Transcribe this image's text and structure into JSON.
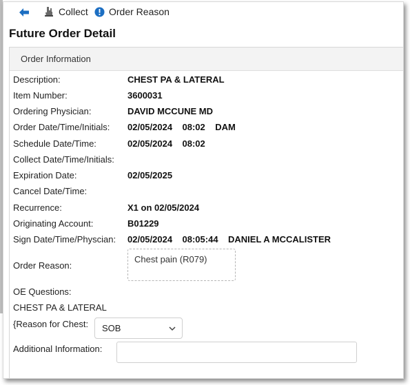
{
  "toolbar": {
    "back_icon": "back-arrow-icon",
    "collect_label": "Collect",
    "collect_icon": "hand-collect-icon",
    "order_reason_label": "Order Reason",
    "order_reason_icon": "info-circle-icon",
    "accent_color": "#1c6ec2"
  },
  "page_title": "Future Order Detail",
  "section": {
    "title": "Order Information",
    "fields": {
      "description": {
        "label": "Description:",
        "value": "CHEST PA & LATERAL"
      },
      "item_number": {
        "label": "Item Number:",
        "value": "3600031"
      },
      "ordering_physician": {
        "label": "Ordering Physician:",
        "value": "DAVID MCCUNE MD"
      },
      "order_datetime": {
        "label": "Order Date/Time/Initials:",
        "value": "02/05/2024    08:02    DAM"
      },
      "schedule_datetime": {
        "label": "Schedule Date/Time:",
        "value": "02/05/2024    08:02"
      },
      "collect_datetime": {
        "label": "Collect Date/Time/Initials:",
        "value": ""
      },
      "expiration_date": {
        "label": "Expiration Date:",
        "value": "02/05/2025"
      },
      "cancel_datetime": {
        "label": "Cancel Date/Time:",
        "value": ""
      },
      "recurrence": {
        "label": "Recurrence:",
        "value": "X1 on 02/05/2024"
      },
      "originating_account": {
        "label": "Originating Account:",
        "value": "B01229"
      },
      "sign_datetime": {
        "label": "Sign Date/Time/Physcian:",
        "value": "02/05/2024    08:05:44    DANIEL A MCCALISTER"
      }
    },
    "order_reason": {
      "label": "Order Reason:",
      "value": "Chest pain (R079)"
    },
    "oe_questions_label": "OE Questions:",
    "oe_exam_name": "CHEST PA & LATERAL",
    "reason_for_chest": {
      "label": "{Reason for Chest:",
      "selected": "SOB"
    },
    "additional_info": {
      "label": "Additional Information:",
      "value": "",
      "placeholder": ""
    }
  }
}
